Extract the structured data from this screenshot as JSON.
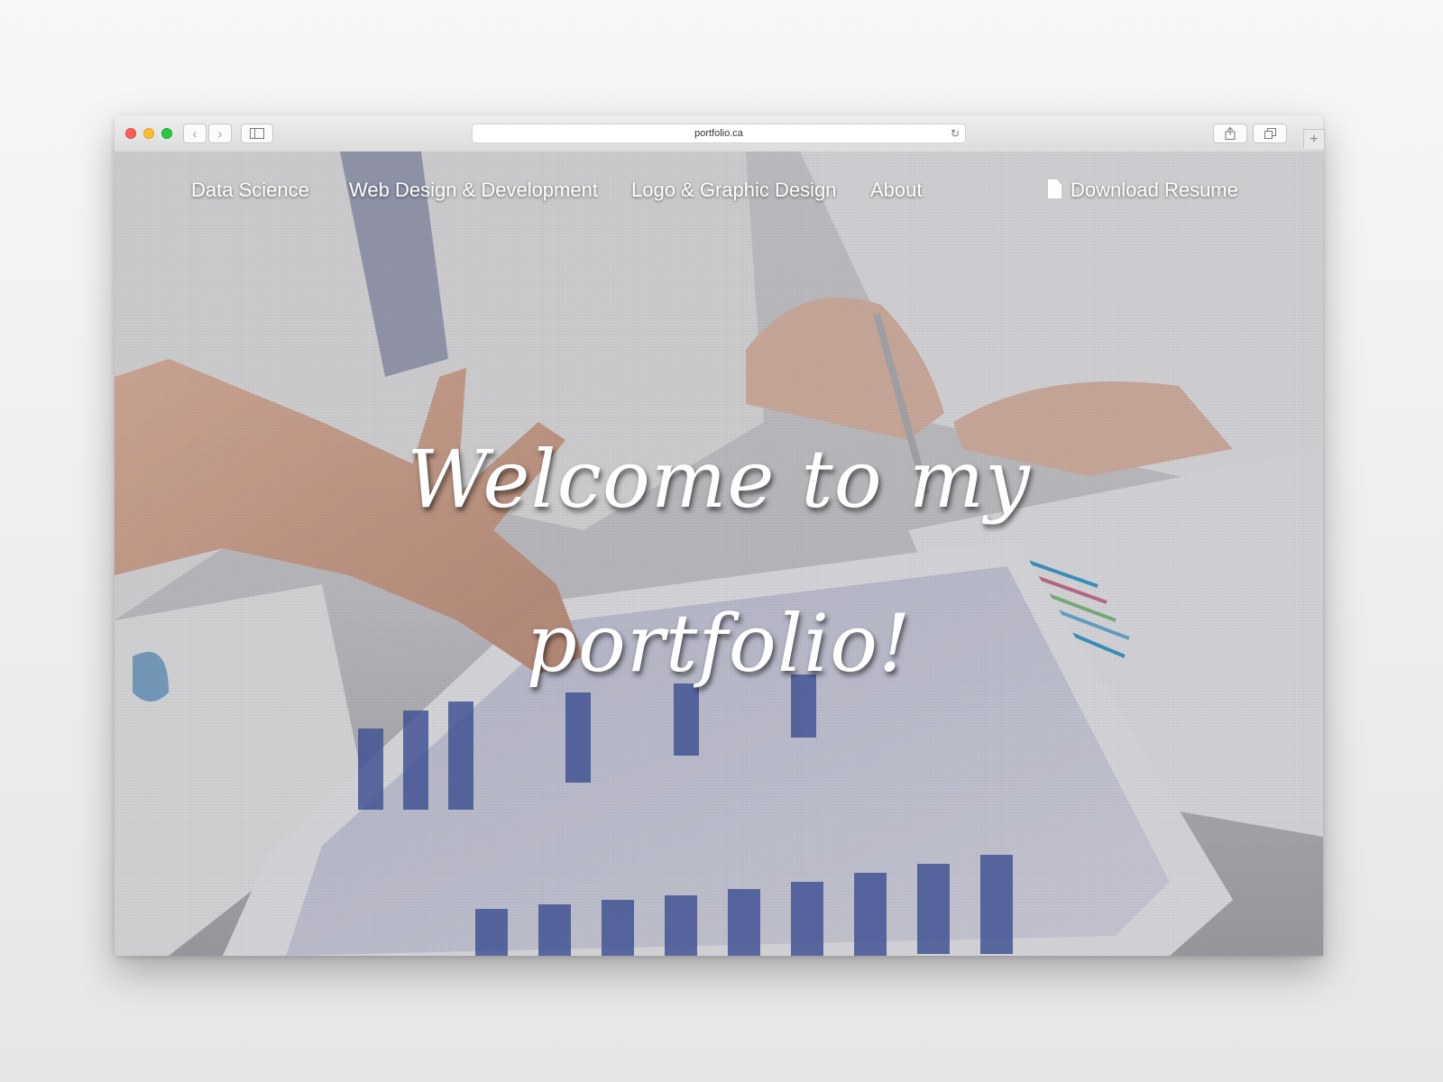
{
  "browser": {
    "url": "portfolio.ca",
    "back_icon": "chevron-left-icon",
    "forward_icon": "chevron-right-icon",
    "sidebar_icon": "sidebar-icon",
    "reload_icon": "reload-icon",
    "share_icon": "share-icon",
    "tabs_icon": "tabs-icon",
    "new_tab_icon": "plus-icon"
  },
  "nav": {
    "items": [
      {
        "label": "Data Science"
      },
      {
        "label": "Web Design & Development"
      },
      {
        "label": "Logo & Graphic Design"
      },
      {
        "label": "About"
      }
    ],
    "download": {
      "label": "Download Resume",
      "icon": "document-icon"
    }
  },
  "hero": {
    "line1": "Welcome to my",
    "line2": "portfolio!"
  },
  "colors": {
    "nav_text": "#ffffff",
    "hero_text": "#ffffff"
  }
}
